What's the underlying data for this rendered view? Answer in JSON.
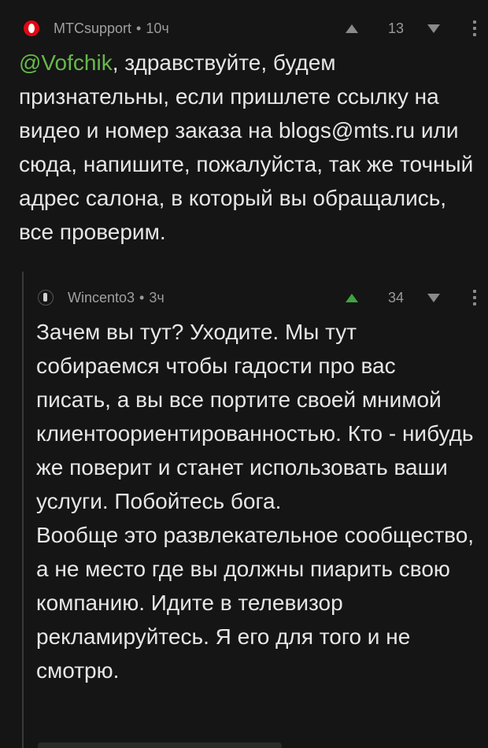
{
  "comments": [
    {
      "author": "МТСsupport",
      "separator": "•",
      "time": "10ч",
      "score": "13",
      "mention": "@Vofchik",
      "text_after_mention": ", здравствуйте, будем признательны, если пришлете ссылку на видео и номер заказа на blogs@mts.ru или сюда, напишите, пожалуйста, так же точный адрес салона, в который вы обращались, все проверим."
    },
    {
      "author": "Wincento3",
      "separator": "•",
      "time": "3ч",
      "score": "34",
      "paragraph1": "Зачем вы тут? Уходите. Мы тут собираемся чтобы гадости про вас писать, а вы все портите своей мнимой клиентоориентированностью. Кто - нибудь же поверит и станет использовать ваши услуги. Побойтесь бога.",
      "paragraph2": "Вообще это развлекательное сообщество, а не место где вы должны пиарить свою компанию. Идите в телевизор рекламируйтесь. Я его для того и не смотрю."
    }
  ],
  "colors": {
    "background": "#151515",
    "text": "#e6e6e6",
    "meta": "#9a9a9a",
    "mention": "#67b84a",
    "upvoted": "#3fa33f",
    "mts_red": "#e30611"
  }
}
